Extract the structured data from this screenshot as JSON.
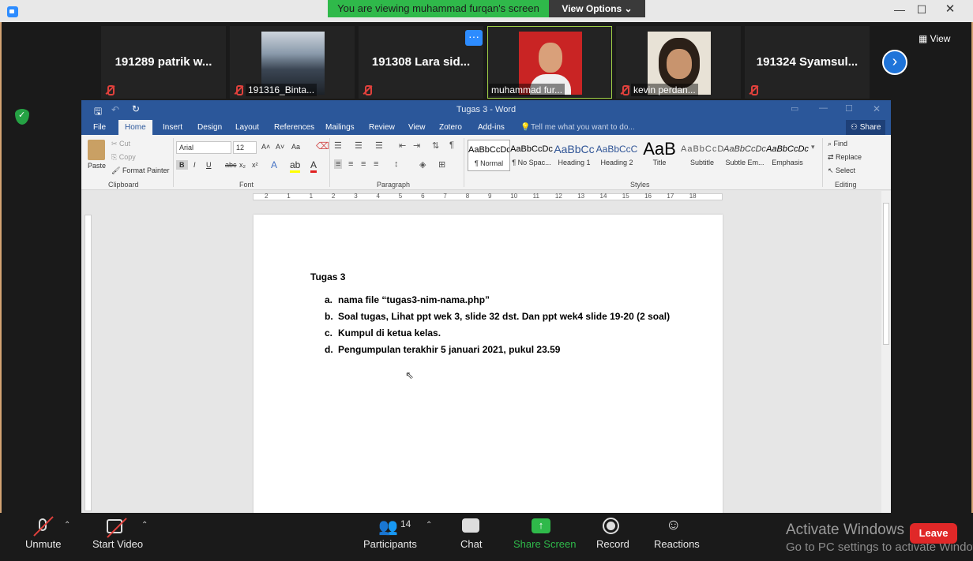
{
  "banner": {
    "viewing": "You are viewing muhammad furqan's screen",
    "view_options": "View Options ⌄"
  },
  "window_controls": {
    "minimize": "—",
    "maximize": "☐",
    "close": "✕"
  },
  "gallery": {
    "tiles": [
      {
        "name": "191289 patrik w...",
        "label": ""
      },
      {
        "name": "",
        "label": "191316_Binta..."
      },
      {
        "name": "191308 Lara sid...",
        "label": ""
      },
      {
        "name": "",
        "label": "muhammad fur..."
      },
      {
        "name": "",
        "label": "kevin perdan..."
      },
      {
        "name": "191324 Syamsul...",
        "label": ""
      }
    ],
    "more_label": "···",
    "next_label": "›",
    "view_label": "View"
  },
  "word": {
    "title": "Tugas 3 - Word",
    "tabs": [
      "File",
      "Home",
      "Insert",
      "Design",
      "Layout",
      "References",
      "Mailings",
      "Review",
      "View",
      "Zotero",
      "Add-ins"
    ],
    "tell_me": "Tell me what you want to do...",
    "share": "Share",
    "clipboard": {
      "paste": "Paste",
      "cut": "Cut",
      "copy": "Copy",
      "format_painter": "Format Painter",
      "group": "Clipboard"
    },
    "font": {
      "name": "Arial",
      "size": "12",
      "group": "Font",
      "grow": "A˄",
      "shrink": "A˅",
      "case": "Aa",
      "bold": "B",
      "italic": "I",
      "underline": "U",
      "strike": "abc",
      "sub": "x₂",
      "sup": "x²"
    },
    "paragraph": {
      "group": "Paragraph"
    },
    "styles": {
      "group": "Styles",
      "items": [
        {
          "preview": "AaBbCcDc",
          "name": "¶ Normal"
        },
        {
          "preview": "AaBbCcDc",
          "name": "¶ No Spac..."
        },
        {
          "preview": "AaBbCc",
          "name": "Heading 1"
        },
        {
          "preview": "AaBbCcC",
          "name": "Heading 2"
        },
        {
          "preview": "AaB",
          "name": "Title"
        },
        {
          "preview": "AaBbCcD",
          "name": "Subtitle"
        },
        {
          "preview": "AaBbCcDc",
          "name": "Subtle Em..."
        },
        {
          "preview": "AaBbCcDc",
          "name": "Emphasis"
        }
      ]
    },
    "editing": {
      "find": "Find",
      "replace": "Replace",
      "select": "Select",
      "group": "Editing"
    },
    "ruler_labels": [
      "2",
      "1",
      "1",
      "2",
      "3",
      "4",
      "5",
      "6",
      "7",
      "8",
      "9",
      "10",
      "11",
      "12",
      "13",
      "14",
      "15",
      "16",
      "17",
      "18"
    ],
    "document": {
      "heading": "Tugas 3",
      "items": [
        {
          "marker": "a.",
          "text": "nama file “tugas3-nim-nama.php”"
        },
        {
          "marker": "b.",
          "text": "Soal tugas, Lihat ppt wek 3, slide 32 dst. Dan ppt wek4 slide 19-20 (2 soal)"
        },
        {
          "marker": "c.",
          "text": "Kumpul di ketua kelas."
        },
        {
          "marker": "d.",
          "text": "Pengumpulan terakhir 5 januari 2021, pukul 23.59"
        }
      ]
    }
  },
  "toolbar": {
    "unmute": "Unmute",
    "start_video": "Start Video",
    "participants": "Participants",
    "participants_count": "14",
    "chat": "Chat",
    "share_screen": "Share Screen",
    "record": "Record",
    "reactions": "Reactions",
    "leave": "Leave",
    "activate_title": "Activate Windows",
    "activate_sub": "Go to PC settings to activate Windows."
  },
  "colors": {
    "share_green": "#2fb94a",
    "word_blue": "#2b579a",
    "zoom_blue": "#2d8cff",
    "leave_red": "#e02828"
  }
}
